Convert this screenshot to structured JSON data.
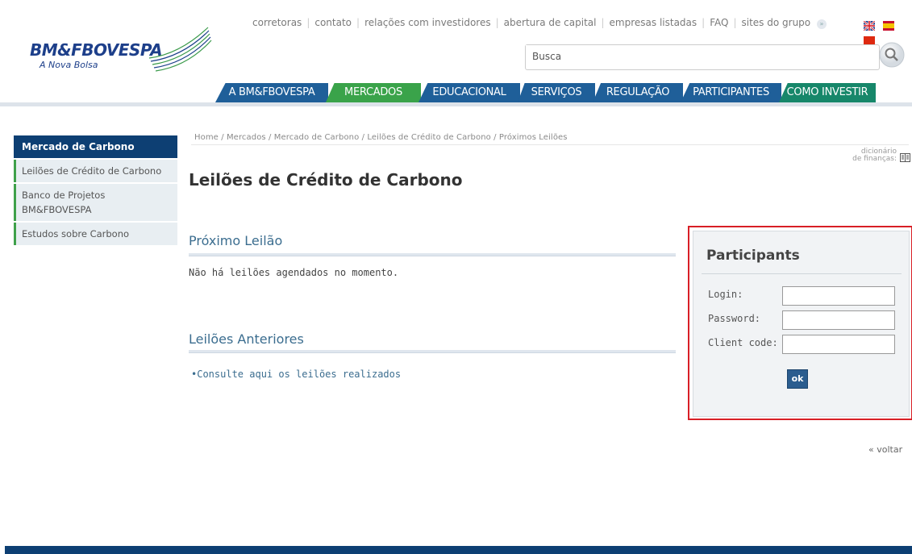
{
  "header": {
    "logo": {
      "brand": "BM&FBOVESPA",
      "tagline": "A Nova Bolsa"
    },
    "top_links": [
      "corretoras",
      "contato",
      "relações com investidores",
      "abertura de capital",
      "empresas listadas",
      "FAQ",
      "sites do grupo"
    ],
    "search": {
      "placeholder": "Busca",
      "value": "Busca"
    },
    "nav_tabs": [
      {
        "label": "A BM&FBOVESPA",
        "color": "#1f5f99"
      },
      {
        "label": "MERCADOS",
        "color": "#3aa34a"
      },
      {
        "label": "EDUCACIONAL",
        "color": "#1f5f99"
      },
      {
        "label": "SERVIÇOS",
        "color": "#1f5f99"
      },
      {
        "label": "REGULAÇÃO",
        "color": "#1f5f99"
      },
      {
        "label": "PARTICIPANTES",
        "color": "#1f5f99"
      },
      {
        "label": "COMO INVESTIR",
        "color": "#17876a"
      }
    ]
  },
  "sidebar": {
    "title": "Mercado de Carbono",
    "items": [
      {
        "label": "Leilões de Crédito de Carbono"
      },
      {
        "label": "Banco de Projetos BM&FBOVESPA"
      },
      {
        "label": "Estudos sobre Carbono"
      }
    ]
  },
  "breadcrumb": "Home  /  Mercados  /  Mercado de Carbono  /  Leilões de Crédito de Carbono  /  Próximos Leilões",
  "dictionary": {
    "line1": "dicionário",
    "line2": "de finanças:"
  },
  "main": {
    "title": "Leilões de Crédito de Carbono",
    "next": {
      "heading": "Próximo Leilão",
      "text": "Não há leilões agendados no momento."
    },
    "previous": {
      "heading": "Leilões Anteriores",
      "link": "•Consulte aqui os leilões realizados"
    }
  },
  "login_panel": {
    "title": "Participants",
    "login_label": "Login:",
    "password_label": "Password:",
    "client_label": "Client code:",
    "ok_label": "ok"
  },
  "back_link": "« voltar",
  "colors": {
    "brand_blue": "#0d3f73",
    "accent_green": "#3aa34a",
    "panel_border": "#d81f26"
  }
}
